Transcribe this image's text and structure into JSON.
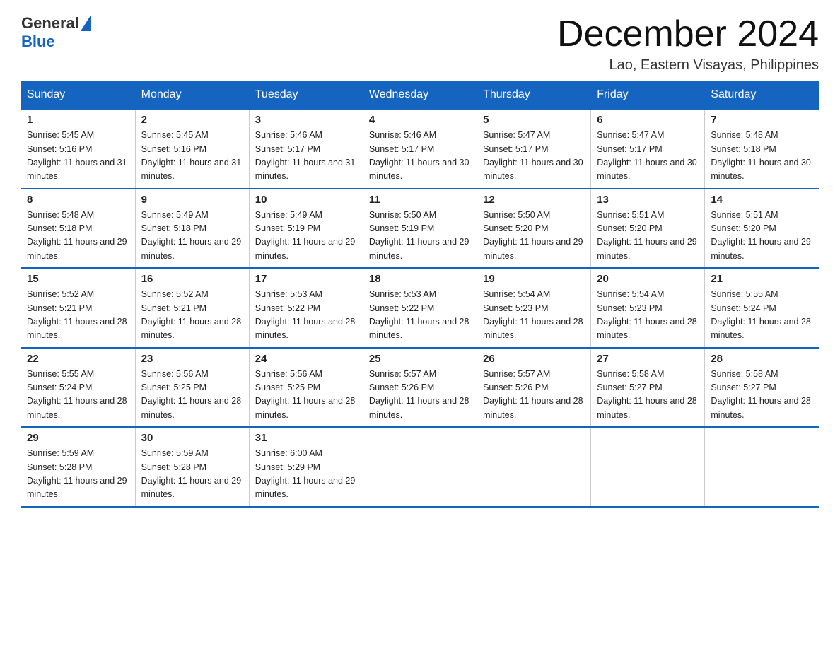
{
  "header": {
    "logo_general": "General",
    "logo_blue": "Blue",
    "month_title": "December 2024",
    "subtitle": "Lao, Eastern Visayas, Philippines"
  },
  "days_of_week": [
    "Sunday",
    "Monday",
    "Tuesday",
    "Wednesday",
    "Thursday",
    "Friday",
    "Saturday"
  ],
  "weeks": [
    [
      {
        "day": "1",
        "sunrise": "5:45 AM",
        "sunset": "5:16 PM",
        "daylight": "11 hours and 31 minutes."
      },
      {
        "day": "2",
        "sunrise": "5:45 AM",
        "sunset": "5:16 PM",
        "daylight": "11 hours and 31 minutes."
      },
      {
        "day": "3",
        "sunrise": "5:46 AM",
        "sunset": "5:17 PM",
        "daylight": "11 hours and 31 minutes."
      },
      {
        "day": "4",
        "sunrise": "5:46 AM",
        "sunset": "5:17 PM",
        "daylight": "11 hours and 30 minutes."
      },
      {
        "day": "5",
        "sunrise": "5:47 AM",
        "sunset": "5:17 PM",
        "daylight": "11 hours and 30 minutes."
      },
      {
        "day": "6",
        "sunrise": "5:47 AM",
        "sunset": "5:17 PM",
        "daylight": "11 hours and 30 minutes."
      },
      {
        "day": "7",
        "sunrise": "5:48 AM",
        "sunset": "5:18 PM",
        "daylight": "11 hours and 30 minutes."
      }
    ],
    [
      {
        "day": "8",
        "sunrise": "5:48 AM",
        "sunset": "5:18 PM",
        "daylight": "11 hours and 29 minutes."
      },
      {
        "day": "9",
        "sunrise": "5:49 AM",
        "sunset": "5:18 PM",
        "daylight": "11 hours and 29 minutes."
      },
      {
        "day": "10",
        "sunrise": "5:49 AM",
        "sunset": "5:19 PM",
        "daylight": "11 hours and 29 minutes."
      },
      {
        "day": "11",
        "sunrise": "5:50 AM",
        "sunset": "5:19 PM",
        "daylight": "11 hours and 29 minutes."
      },
      {
        "day": "12",
        "sunrise": "5:50 AM",
        "sunset": "5:20 PM",
        "daylight": "11 hours and 29 minutes."
      },
      {
        "day": "13",
        "sunrise": "5:51 AM",
        "sunset": "5:20 PM",
        "daylight": "11 hours and 29 minutes."
      },
      {
        "day": "14",
        "sunrise": "5:51 AM",
        "sunset": "5:20 PM",
        "daylight": "11 hours and 29 minutes."
      }
    ],
    [
      {
        "day": "15",
        "sunrise": "5:52 AM",
        "sunset": "5:21 PM",
        "daylight": "11 hours and 28 minutes."
      },
      {
        "day": "16",
        "sunrise": "5:52 AM",
        "sunset": "5:21 PM",
        "daylight": "11 hours and 28 minutes."
      },
      {
        "day": "17",
        "sunrise": "5:53 AM",
        "sunset": "5:22 PM",
        "daylight": "11 hours and 28 minutes."
      },
      {
        "day": "18",
        "sunrise": "5:53 AM",
        "sunset": "5:22 PM",
        "daylight": "11 hours and 28 minutes."
      },
      {
        "day": "19",
        "sunrise": "5:54 AM",
        "sunset": "5:23 PM",
        "daylight": "11 hours and 28 minutes."
      },
      {
        "day": "20",
        "sunrise": "5:54 AM",
        "sunset": "5:23 PM",
        "daylight": "11 hours and 28 minutes."
      },
      {
        "day": "21",
        "sunrise": "5:55 AM",
        "sunset": "5:24 PM",
        "daylight": "11 hours and 28 minutes."
      }
    ],
    [
      {
        "day": "22",
        "sunrise": "5:55 AM",
        "sunset": "5:24 PM",
        "daylight": "11 hours and 28 minutes."
      },
      {
        "day": "23",
        "sunrise": "5:56 AM",
        "sunset": "5:25 PM",
        "daylight": "11 hours and 28 minutes."
      },
      {
        "day": "24",
        "sunrise": "5:56 AM",
        "sunset": "5:25 PM",
        "daylight": "11 hours and 28 minutes."
      },
      {
        "day": "25",
        "sunrise": "5:57 AM",
        "sunset": "5:26 PM",
        "daylight": "11 hours and 28 minutes."
      },
      {
        "day": "26",
        "sunrise": "5:57 AM",
        "sunset": "5:26 PM",
        "daylight": "11 hours and 28 minutes."
      },
      {
        "day": "27",
        "sunrise": "5:58 AM",
        "sunset": "5:27 PM",
        "daylight": "11 hours and 28 minutes."
      },
      {
        "day": "28",
        "sunrise": "5:58 AM",
        "sunset": "5:27 PM",
        "daylight": "11 hours and 28 minutes."
      }
    ],
    [
      {
        "day": "29",
        "sunrise": "5:59 AM",
        "sunset": "5:28 PM",
        "daylight": "11 hours and 29 minutes."
      },
      {
        "day": "30",
        "sunrise": "5:59 AM",
        "sunset": "5:28 PM",
        "daylight": "11 hours and 29 minutes."
      },
      {
        "day": "31",
        "sunrise": "6:00 AM",
        "sunset": "5:29 PM",
        "daylight": "11 hours and 29 minutes."
      },
      null,
      null,
      null,
      null
    ]
  ],
  "labels": {
    "sunrise_prefix": "Sunrise: ",
    "sunset_prefix": "Sunset: ",
    "daylight_prefix": "Daylight: "
  }
}
